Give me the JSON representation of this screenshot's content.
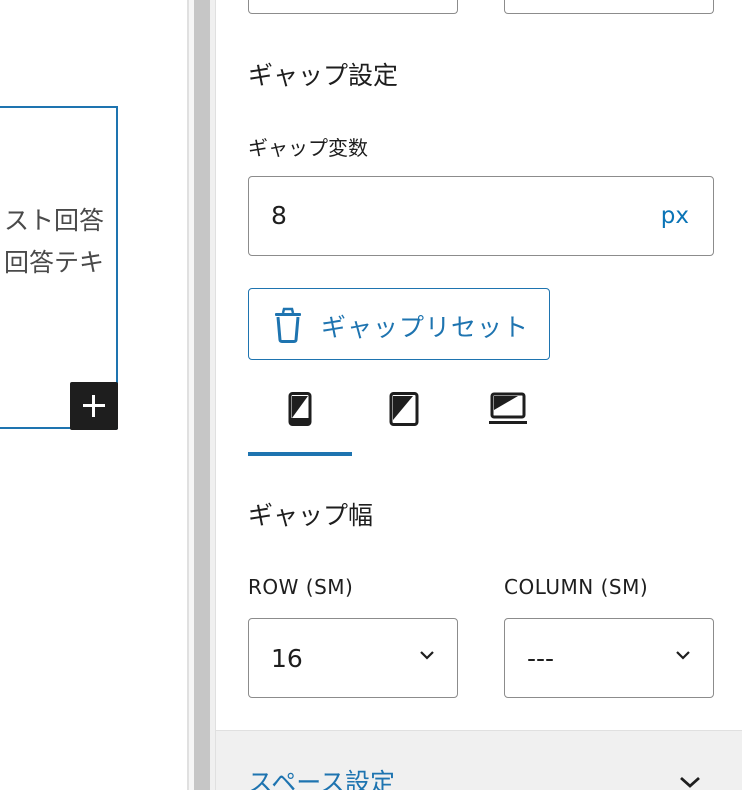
{
  "canvas": {
    "block_text_line1": "スト回答",
    "block_text_line2": "回答テキ"
  },
  "gap_settings": {
    "heading": "ギャップ設定",
    "variable_label": "ギャップ変数",
    "variable_value": "8",
    "variable_unit": "px",
    "reset_label": "ギャップリセット"
  },
  "device_tabs": [
    {
      "icon": "mobile-icon",
      "active": true
    },
    {
      "icon": "tablet-icon",
      "active": false
    },
    {
      "icon": "laptop-icon",
      "active": false
    }
  ],
  "gap_width": {
    "heading": "ギャップ幅",
    "row_label": "ROW (SM)",
    "row_value": "16",
    "column_label": "COLUMN (SM)",
    "column_value": "---"
  },
  "space_settings": {
    "title": "スペース設定"
  },
  "colors": {
    "accent": "#1e74b0",
    "unit_text": "#0a74b6",
    "border": "#8c8c8c",
    "scrollbar": "#c6c6c6",
    "dark_button": "#1e1e1e"
  }
}
